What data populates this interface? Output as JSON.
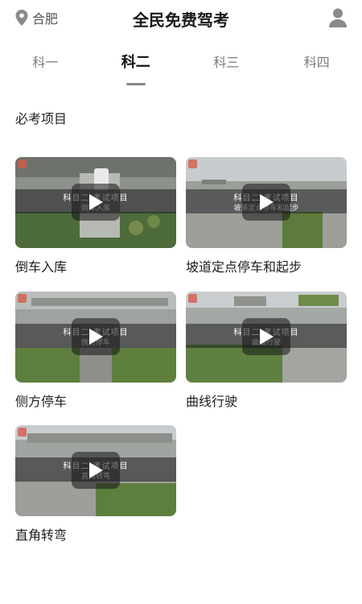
{
  "header": {
    "location": "合肥",
    "title": "全民免费驾考"
  },
  "tabs": [
    {
      "label": "科一",
      "active": false
    },
    {
      "label": "科二",
      "active": true
    },
    {
      "label": "科三",
      "active": false
    },
    {
      "label": "科四",
      "active": false
    }
  ],
  "section_title": "必考项目",
  "cards": [
    {
      "label": "倒车入库",
      "banner_line1": "科目二·考试项目",
      "banner_line2": "倒车入库"
    },
    {
      "label": "坡道定点停车和起步",
      "banner_line1": "科目二·考试项目",
      "banner_line2": "坡道定点停车和起步"
    },
    {
      "label": "侧方停车",
      "banner_line1": "科目二·考试项目",
      "banner_line2": "侧方停车"
    },
    {
      "label": "曲线行驶",
      "banner_line1": "科目二·考试项目",
      "banner_line2": "曲线行驶"
    },
    {
      "label": "直角转弯",
      "banner_line1": "科目二·考试项目",
      "banner_line2": "直角转弯"
    }
  ],
  "colors": {
    "active_tab": "#111111",
    "inactive_tab": "#7b7b7b",
    "badge": "#d65a4a"
  }
}
